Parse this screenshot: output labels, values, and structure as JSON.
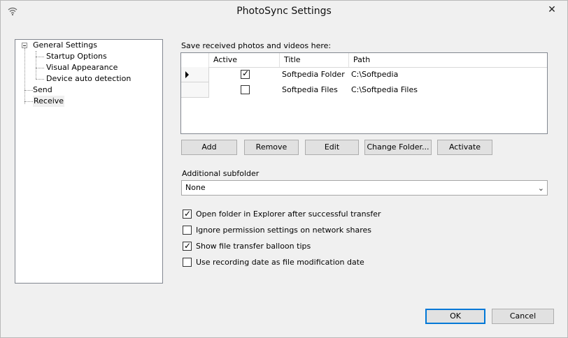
{
  "window": {
    "title": "PhotoSync Settings"
  },
  "icons": {
    "app": "wifi-icon",
    "close": "close-icon",
    "row_pointer": "row-pointer-icon"
  },
  "tree": {
    "root": "General Settings",
    "children": [
      "Startup Options",
      "Visual Appearance",
      "Device auto detection"
    ],
    "others": [
      "Send",
      "Receive"
    ],
    "selected": "Receive"
  },
  "save_section": {
    "label": "Save received photos and videos here:",
    "columns": [
      "Active",
      "Title",
      "Path"
    ],
    "rows": [
      {
        "active": true,
        "title": "Softpedia Folder",
        "path": "C:\\Softpedia",
        "current": true
      },
      {
        "active": false,
        "title": "Softpedia Files",
        "path": "C:\\Softpedia Files",
        "current": false
      }
    ]
  },
  "buttons": {
    "add": "Add",
    "remove": "Remove",
    "edit": "Edit",
    "change_folder": "Change Folder...",
    "activate": "Activate",
    "ok": "OK",
    "cancel": "Cancel"
  },
  "subfolder": {
    "label": "Additional subfolder",
    "value": "None"
  },
  "options": [
    {
      "label": "Open folder in Explorer after successful transfer",
      "checked": true
    },
    {
      "label": "Ignore permission settings on network shares",
      "checked": false
    },
    {
      "label": "Show file transfer balloon tips",
      "checked": true
    },
    {
      "label": "Use recording date as file modification date",
      "checked": false
    }
  ]
}
